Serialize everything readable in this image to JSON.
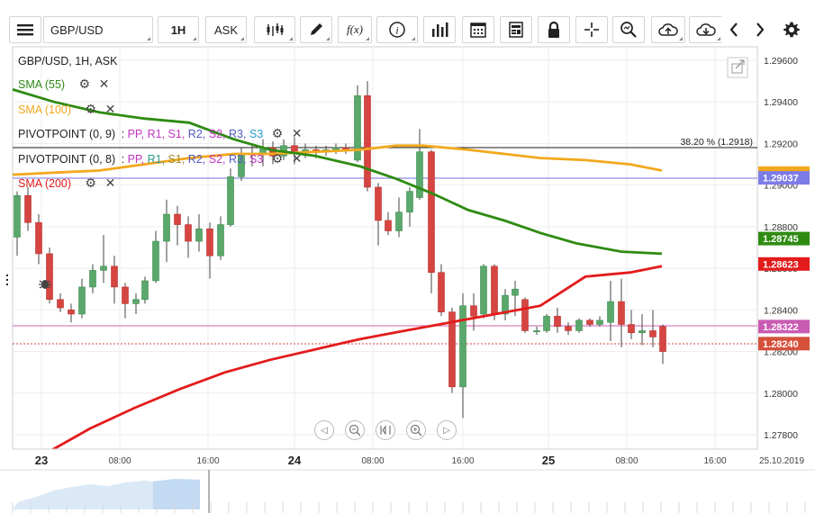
{
  "toolbar": {
    "menu_icon": "hamburger-icon",
    "symbol": "GBP/USD",
    "timeframe": "1H",
    "price_type": "ASK",
    "fx_label": "f(x)",
    "info_label": "i"
  },
  "legend": {
    "title": "GBP/USD, 1H, ASK",
    "sma55": "SMA (55)",
    "sma100": "SMA (100)",
    "pivot1_name": "PIVOTPOINT (0, 9)",
    "pivot2_name": "PIVOTPOINT (0, 8)",
    "pivot_sep": ":",
    "pp": "PP,",
    "r1": "R1,",
    "s1": "S1,",
    "r2": "R2,",
    "s2": "S2,",
    "r3": "R3,",
    "s3": "S3",
    "sma200": "SMA (200)"
  },
  "colors": {
    "sma55": "#2e8b12",
    "sma100": "#f2a81d",
    "sma200": "#e31b1b",
    "bull": "#5aa86b",
    "bear": "#d64541",
    "pink_line": "#d97fc0",
    "blue_line": "#8d8de0"
  },
  "fib_label": "38.20 % (1.2918)",
  "axis": {
    "y_ticks": [
      "1.29600",
      "1.29400",
      "1.29200",
      "1.29000",
      "1.28800",
      "1.28600",
      "1.28400",
      "1.28200",
      "1.28000",
      "1.27800"
    ],
    "x_major": [
      "23",
      "24",
      "25"
    ],
    "x_minor": [
      "08:00",
      "16:00",
      "08:00",
      "16:00",
      "08:00",
      "16:00"
    ],
    "date_label": "25.10.2019"
  },
  "price_tags": {
    "t1": "1.29037",
    "t2": "1.28745",
    "t3": "1.28623",
    "t4": "1.28322",
    "t5": "1.28240"
  }
}
